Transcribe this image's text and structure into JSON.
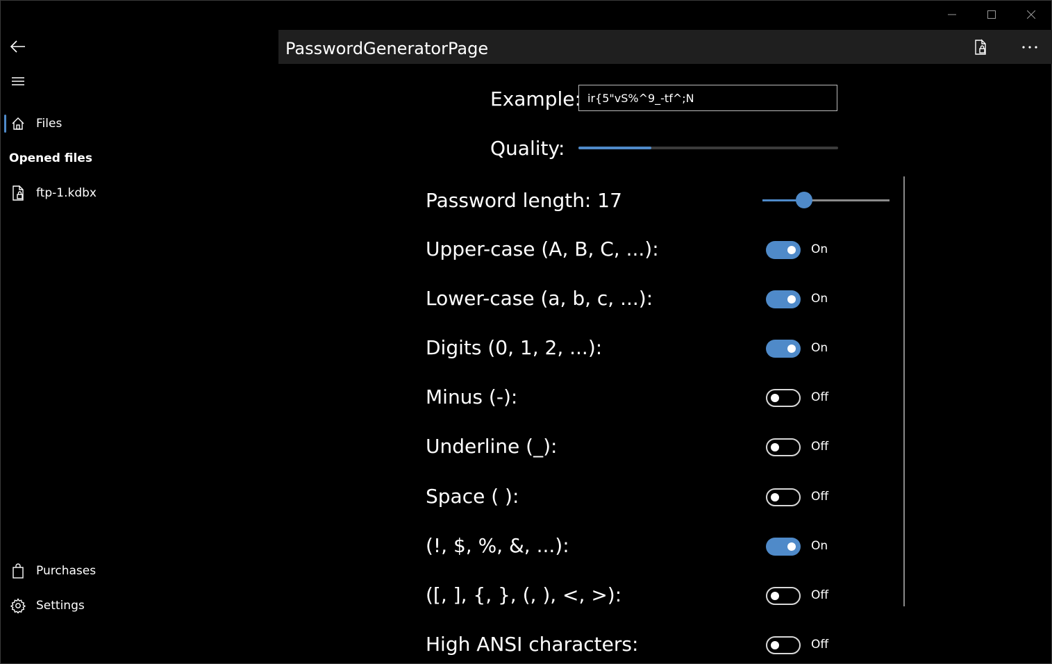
{
  "window": {
    "caption_buttons": [
      "minimize-icon",
      "maximize-icon",
      "close-icon"
    ]
  },
  "nav": {
    "back_icon": "back-arrow-icon",
    "menu_icon": "hamburger-icon",
    "files_label": "Files",
    "opened_files_header": "Opened files",
    "opened_file_label": "ftp-1.kdbx",
    "purchases_label": "Purchases",
    "settings_label": "Settings"
  },
  "header": {
    "title": "PasswordGeneratorPage",
    "lock_icon": "lock-document-icon",
    "more_icon": "more-icon"
  },
  "generator": {
    "example_label": "Example:",
    "example_value": "ir{5\"vS%^9_-tf^;N",
    "quality_label": "Quality:",
    "quality_fraction": 0.28,
    "length_label": "Password length: 17",
    "length_value": 17,
    "length_min": 1,
    "length_max": 50,
    "options": [
      {
        "label": "Upper-case (A, B, C, ...):",
        "on": true,
        "state": "On"
      },
      {
        "label": "Lower-case (a, b, c, ...):",
        "on": true,
        "state": "On"
      },
      {
        "label": "Digits (0, 1, 2, ...):",
        "on": true,
        "state": "On"
      },
      {
        "label": "Minus (-):",
        "on": false,
        "state": "Off"
      },
      {
        "label": "Underline (_):",
        "on": false,
        "state": "Off"
      },
      {
        "label": "Space ( ):",
        "on": false,
        "state": "Off"
      },
      {
        "label": "(!, $, %, &, ...):",
        "on": true,
        "state": "On"
      },
      {
        "label": "([, ], {, }, (, ), <, >):",
        "on": false,
        "state": "Off"
      },
      {
        "label": "High ANSI characters:",
        "on": false,
        "state": "Off"
      }
    ]
  },
  "colors": {
    "accent": "#4f8ac9",
    "background": "#000000",
    "header_bg": "#1f1f1f"
  }
}
